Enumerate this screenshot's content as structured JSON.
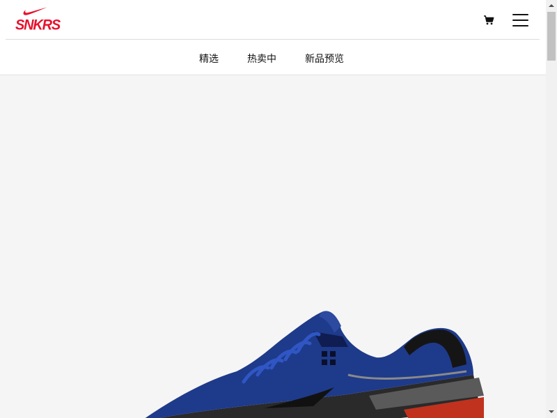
{
  "brand": {
    "logo_text": "SNKRS",
    "color": "#e8112d"
  },
  "header": {
    "cart_icon": "cart-icon",
    "menu_icon": "hamburger-menu-icon"
  },
  "nav": {
    "items": [
      {
        "label": "精选"
      },
      {
        "label": "热卖中"
      },
      {
        "label": "新品预览"
      }
    ]
  },
  "hero": {
    "background": "#f5f5f5",
    "image": "sneaker-product-image"
  }
}
